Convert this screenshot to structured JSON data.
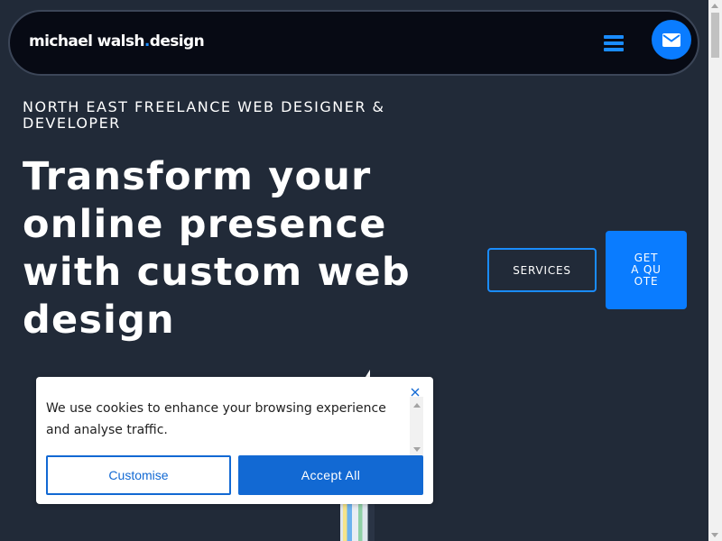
{
  "header": {
    "logo": {
      "part1": "michael walsh",
      "dot": ".",
      "part2": "design"
    },
    "menu_icon": "hamburger-icon",
    "contact_icon": "envelope-icon"
  },
  "hero": {
    "eyebrow": "NORTH EAST FREELANCE WEB DESIGNER & DEVELOPER",
    "headline": "Transform your online presence with custom web design",
    "buttons": {
      "services": "SERVICES",
      "quote": "GET A QUOTE"
    }
  },
  "cookie_banner": {
    "message": "We use cookies to enhance your browsing experience and analyse traffic.",
    "close_icon": "close-icon",
    "customise_label": "Customise",
    "accept_label": "Accept All"
  },
  "colors": {
    "background": "#212a38",
    "header_bg": "#070a14",
    "accent": "#0a7cff",
    "cookie_button": "#1269d3"
  }
}
